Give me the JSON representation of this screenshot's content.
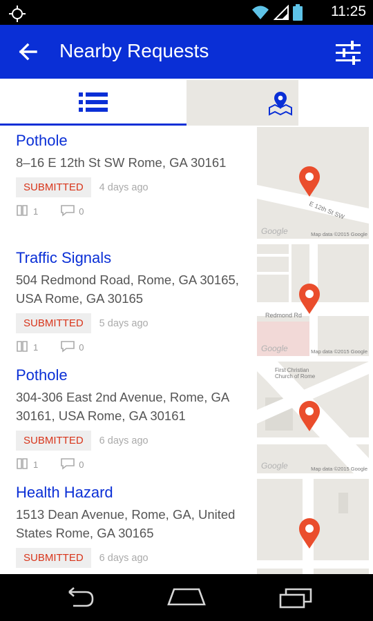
{
  "status_bar": {
    "time": "11:25"
  },
  "app_bar": {
    "title": "Nearby Requests"
  },
  "tabs": {
    "list_icon": "list-icon",
    "map_icon": "map-pin-icon",
    "active_color": "#0a2fd6"
  },
  "requests": [
    {
      "category": "Pothole",
      "address": "8–16 E 12th St SW Rome, GA 30161",
      "status": "SUBMITTED",
      "age": "4 days ago",
      "votes": "1",
      "comments": "0",
      "map": {
        "street_label": "E 12th St SW",
        "google": "Google",
        "map_data": "Map data ©2015 Google"
      }
    },
    {
      "category": "Traffic Signals",
      "address": "504 Redmond Road, Rome, GA 30165, USA Rome, GA 30165",
      "status": "SUBMITTED",
      "age": "5 days ago",
      "votes": "1",
      "comments": "0",
      "map": {
        "street_label": "Redmond Rd",
        "google": "Google",
        "map_data": "Map data ©2015 Google"
      }
    },
    {
      "category": "Pothole",
      "address": "304-306 East 2nd Avenue, Rome, GA 30161, USA Rome, GA 30161",
      "status": "SUBMITTED",
      "age": "6 days ago",
      "votes": "1",
      "comments": "0",
      "map": {
        "street_label": "First Christian Church of Rome",
        "google": "Google",
        "map_data": "Map data ©2015 Google"
      }
    },
    {
      "category": "Health Hazard",
      "address": "1513 Dean Avenue, Rome, GA, United States Rome, GA 30165",
      "status": "SUBMITTED",
      "age": "6 days ago",
      "votes": "",
      "comments": "",
      "map": {
        "street_label": "",
        "google": "",
        "map_data": ""
      }
    }
  ],
  "colors": {
    "primary": "#0a2fd6",
    "status_text": "#d8341a",
    "pin": "#ea4d2c"
  }
}
